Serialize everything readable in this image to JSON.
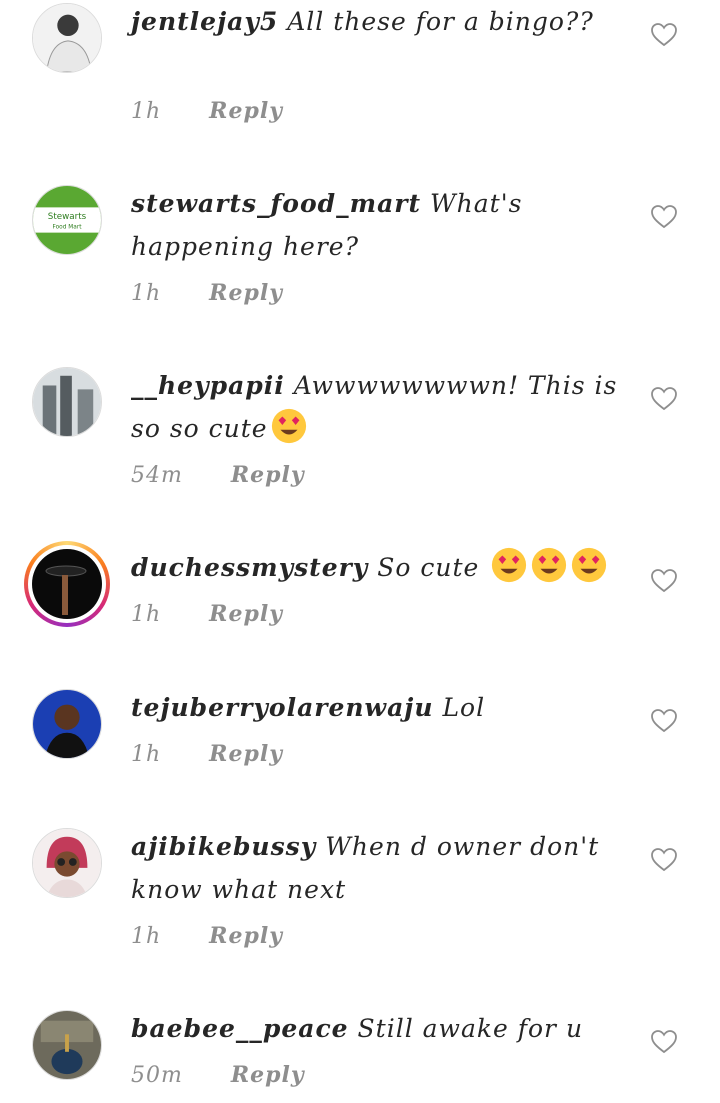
{
  "comments": [
    {
      "username": "jentlejay5",
      "text": "All these for a bingo??",
      "time": "1h",
      "reply": "Reply",
      "emojis": 0
    },
    {
      "username": "stewarts_food_mart",
      "text": "What's happening here?",
      "time": "1h",
      "reply": "Reply",
      "emojis": 0
    },
    {
      "username": "__heypapii",
      "text": "Awwwwwwwwn! This is so so cute",
      "time": "54m",
      "reply": "Reply",
      "emojis": 1
    },
    {
      "username": "duchessmystery",
      "text": "So cute",
      "time": "1h",
      "reply": "Reply",
      "emojis": 3
    },
    {
      "username": "tejuberryolarenwaju",
      "text": "Lol",
      "time": "1h",
      "reply": "Reply",
      "emojis": 0
    },
    {
      "username": "ajibikebussy",
      "text": "When d owner don't know what next",
      "time": "1h",
      "reply": "Reply",
      "emojis": 0
    },
    {
      "username": "baebee__peace",
      "text": "Still awake for u",
      "time": "50m",
      "reply": "Reply",
      "emojis": 0
    }
  ],
  "icons": {
    "like": "heart-outline-icon",
    "emoji": "heart-eyes-emoji"
  },
  "colors": {
    "text": "#262626",
    "meta": "#8e8e8e",
    "story_ring_start": "#feda75",
    "story_ring_end": "#962fbf"
  }
}
